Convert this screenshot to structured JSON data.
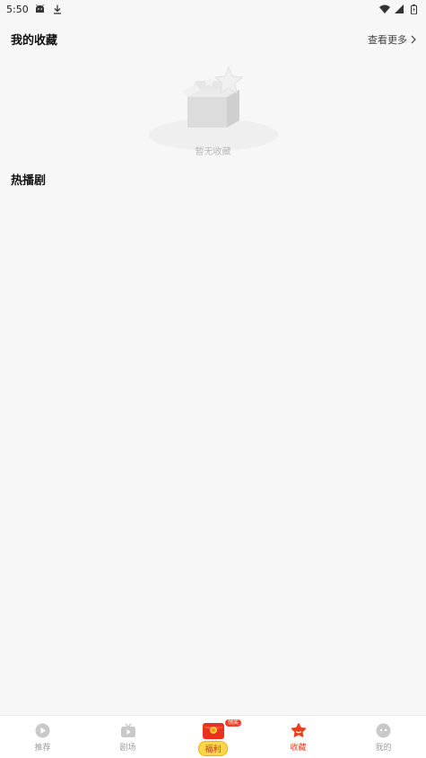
{
  "status_bar": {
    "time": "5:50",
    "left_icons": [
      "android-icon",
      "download-icon"
    ],
    "right_icons": [
      "wifi-icon",
      "signal-icon",
      "battery-icon"
    ]
  },
  "favorites": {
    "title": "我的收藏",
    "view_more": "查看更多",
    "empty_text": "暂无收藏"
  },
  "hot_dramas": {
    "title": "热播剧"
  },
  "tabbar": {
    "active_color": "#e8401e",
    "tabs": [
      {
        "label": "推荐",
        "icon": "play-icon"
      },
      {
        "label": "剧场",
        "icon": "tv-icon"
      },
      {
        "label": "福利",
        "icon": "red-envelope-icon",
        "badge": "领奖"
      },
      {
        "label": "收藏",
        "icon": "star-icon",
        "active": true
      },
      {
        "label": "我的",
        "icon": "profile-icon"
      }
    ]
  }
}
